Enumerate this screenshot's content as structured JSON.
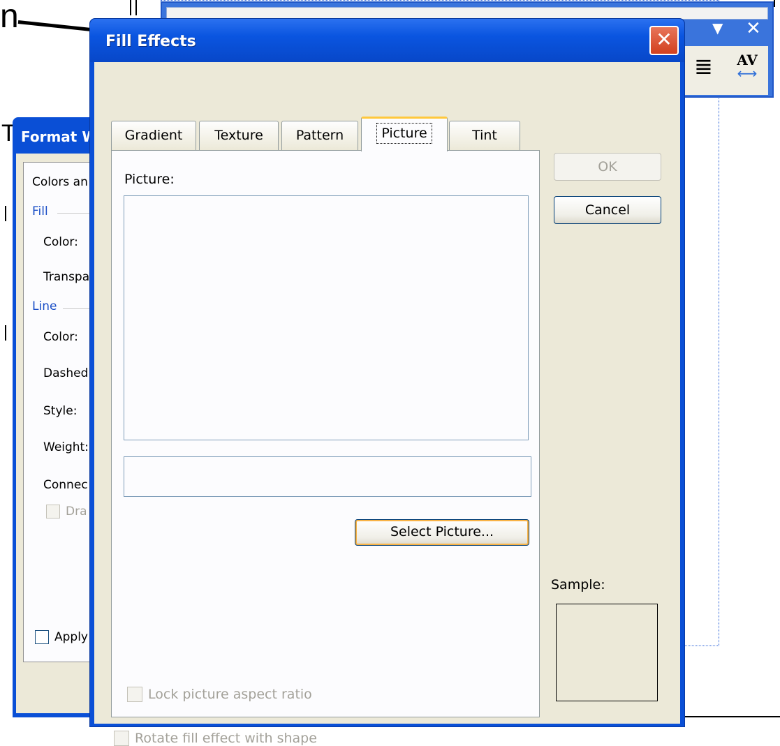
{
  "background": {
    "partial_letter": "n",
    "partial_letter_2": "T"
  },
  "toolbar_window": {
    "dropdown_icon": "▼",
    "close_icon": "✕",
    "align_icon": "≣",
    "spacing_label": "AV",
    "spacing_arrows": "⟷"
  },
  "format_dialog": {
    "title": "Format W",
    "tab_label": "Colors an",
    "fill_section": "Fill",
    "color_label": "Color:",
    "transparency_label": "Transpa",
    "line_section": "Line",
    "line_color_label": "Color:",
    "dashed_label": "Dashed",
    "style_label": "Style:",
    "weight_label": "Weight:",
    "connector_label": "Connec",
    "draw_label": "Dra",
    "apply_label": "Apply"
  },
  "fill_effects": {
    "title": "Fill Effects",
    "close_glyph": "✕",
    "tabs": [
      {
        "label": "Gradient",
        "active": false
      },
      {
        "label": "Texture",
        "active": false
      },
      {
        "label": "Pattern",
        "active": false
      },
      {
        "label": "Picture",
        "active": true
      },
      {
        "label": "Tint",
        "active": false
      }
    ],
    "picture_label": "Picture:",
    "select_picture_button": "Select Picture...",
    "lock_aspect_label": "Lock picture aspect ratio",
    "ok_button": "OK",
    "cancel_button": "Cancel",
    "sample_label": "Sample:",
    "rotate_label": "Rotate fill effect with shape"
  }
}
